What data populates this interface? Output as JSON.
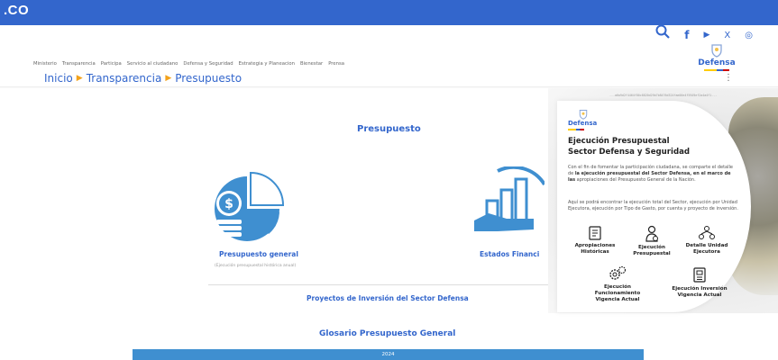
{
  "topbar": {
    "brand_text": ".CO",
    "color": "#3366cc"
  },
  "header_icons": [
    "search-icon",
    "facebook-icon",
    "youtube-icon",
    "x-icon",
    "instagram-icon"
  ],
  "header_glyphs": {
    "facebook": "f",
    "youtube": "▶",
    "x": "X",
    "instagram": "◎"
  },
  "logo": {
    "text": "Defensa"
  },
  "nav": {
    "items": [
      "Ministerio",
      "Transparencia",
      "Participa",
      "Servicio al ciudadano",
      "Defensa y Seguridad",
      "Estrategia y Planeacion",
      "Bienestar",
      "Prensa"
    ]
  },
  "breadcrumb": {
    "items": [
      "Inicio",
      "Transparencia",
      "Presupuesto"
    ]
  },
  "main": {
    "title": "Presupuesto",
    "card1_label": "Presupuesto general",
    "card1_sub": "(Ejecución presupuestal histórica anual)",
    "card2_label": "Estados Financi",
    "projects_link": "Proyectos de Inversión del Sector Defensa",
    "glossary_title": "Glosario Presupuesto General",
    "year": "2024"
  },
  "popup": {
    "hash": "...a6a9d2f4464f80c8820d29b7b8476d324fae00e4f5949ef2a4a4f1...",
    "logo_text": "Defensa",
    "title_line1": "Ejecución Presupuestal",
    "title_line2": "Sector Defensa y Seguridad",
    "para1_a": "Con el fin de fomentar la participación ciudadana, se comparte el detalle de ",
    "para1_b": "la ejecución presupuestal del Sector Defensa, en el marco de las",
    "para1_c": " apropiaciones del Presupuesto General de la Nación.",
    "para2": "Aquí se podrá encontrar la ejecución total del Sector, ejecución por Unidad Ejecutora, ejecución por Tipo de Gasto, por cuenta y proyecto de inversión.",
    "items": [
      {
        "label_1": "Apropiaciones",
        "label_2": "Históricas",
        "icon": "document-icon"
      },
      {
        "label_1": "Ejecución",
        "label_2": "Presupuestal",
        "icon": "person-money-icon"
      },
      {
        "label_1": "Detalle Unidad",
        "label_2": "Ejecutora",
        "icon": "network-icon"
      },
      {
        "label_1": "Ejecución",
        "label_2": "Funcionamiento",
        "label_3": "Vigencia Actual",
        "icon": "gears-icon"
      },
      {
        "label_1": "Ejecución Inversión",
        "label_2": "Vigencia Actual",
        "icon": "report-icon"
      }
    ]
  }
}
